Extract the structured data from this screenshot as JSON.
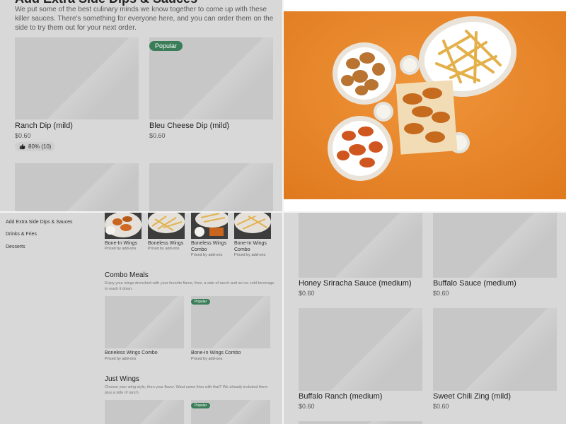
{
  "top_left": {
    "heading": "Add Extra Side Dips & Sauces",
    "description": "We put some of the best culinary minds we know together to come up with these killer sauces. There's something for everyone here, and you can order them on the side to try them out for your next order.",
    "items": [
      {
        "name": "Ranch Dip (mild)",
        "price": "$0.60",
        "rating": "80% (10)"
      },
      {
        "name": "Bleu Cheese Dip (mild)",
        "price": "$0.60",
        "badge": "Popular"
      }
    ]
  },
  "top_right": {
    "photo_icon": "wings-and-fries-photo"
  },
  "bottom_left": {
    "menu": [
      "Add Extra Side Dips & Sauces",
      "Drinks & Fries",
      "Desserts"
    ],
    "top_items": [
      {
        "name": "Bone-In Wings",
        "sub": "Priced by add-ons"
      },
      {
        "name": "Boneless Wings",
        "sub": "Priced by add-ons"
      },
      {
        "name": "Boneless Wings Combo",
        "sub": "Priced by add-ons"
      },
      {
        "name": "Bone-In Wings Combo",
        "sub": "Priced by add-ons"
      }
    ],
    "combo": {
      "title": "Combo Meals",
      "description": "Enjoy your wings drenched with your favorite flavor, fries, a side of ranch and an ice cold beverage to wash it down.",
      "items": [
        {
          "name": "Boneless Wings Combo",
          "sub": "Priced by add-ons"
        },
        {
          "name": "Bone-In Wings Combo",
          "sub": "Priced by add-ons",
          "badge": "Popular"
        }
      ]
    },
    "just_wings": {
      "title": "Just Wings",
      "description": "Choose your wing style, then your flavor. Want some fries with that? We already included them plus a side of ranch.",
      "badge": "Popular"
    }
  },
  "bottom_right": {
    "items": [
      {
        "name": "Honey Sriracha Sauce (medium)",
        "price": "$0.60"
      },
      {
        "name": "Buffalo Sauce (medium)",
        "price": "$0.60"
      },
      {
        "name": "Buffalo Ranch (medium)",
        "price": "$0.60"
      },
      {
        "name": "Sweet Chili Zing (mild)",
        "price": "$0.60"
      }
    ]
  },
  "colors": {
    "badge": "#3a7d58",
    "overlay_gray": "#d8d8d8",
    "placeholder": "#c7c7c7",
    "photo_bg": "#ec8a2a"
  }
}
